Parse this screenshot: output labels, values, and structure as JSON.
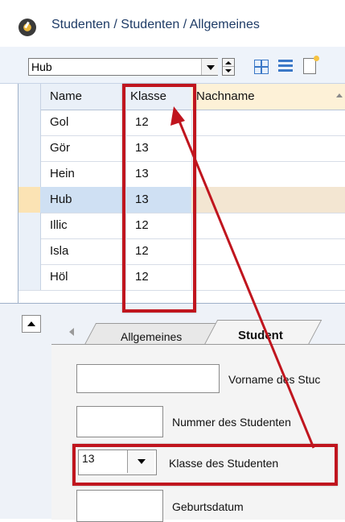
{
  "window": {
    "title": "Studenten / Studenten / Allgemeines",
    "icon": "app-clock-icon"
  },
  "toolbar": {
    "record_select_value": "Hub",
    "buttons": [
      "spin-icon",
      "grid-icon",
      "list-icon",
      "new-document-icon"
    ]
  },
  "grid": {
    "columns": {
      "name": "Name",
      "klasse": "Klasse",
      "nachname": "Nachname"
    },
    "rows": [
      {
        "name": "Gol",
        "klasse": "12",
        "nachname": ""
      },
      {
        "name": "Gör",
        "klasse": "13",
        "nachname": ""
      },
      {
        "name": "Hein",
        "klasse": "13",
        "nachname": ""
      },
      {
        "name": "Hub",
        "klasse": "13",
        "nachname": "",
        "selected": true
      },
      {
        "name": "Illic",
        "klasse": "12",
        "nachname": ""
      },
      {
        "name": "Isla",
        "klasse": "12",
        "nachname": ""
      },
      {
        "name": "Höl",
        "klasse": "12",
        "nachname": ""
      }
    ]
  },
  "detail": {
    "tabs": [
      "Allgemeines",
      "Student"
    ],
    "active_tab": "Student",
    "fields": {
      "vorname_label": "Vorname des Stuc",
      "nummer_label": "Nummer des Studenten",
      "klasse_value": "13",
      "klasse_label": "Klasse des Studenten",
      "geburtsdatum_label": "Geburtsdatum"
    }
  },
  "annotation_color": "#c0151e"
}
